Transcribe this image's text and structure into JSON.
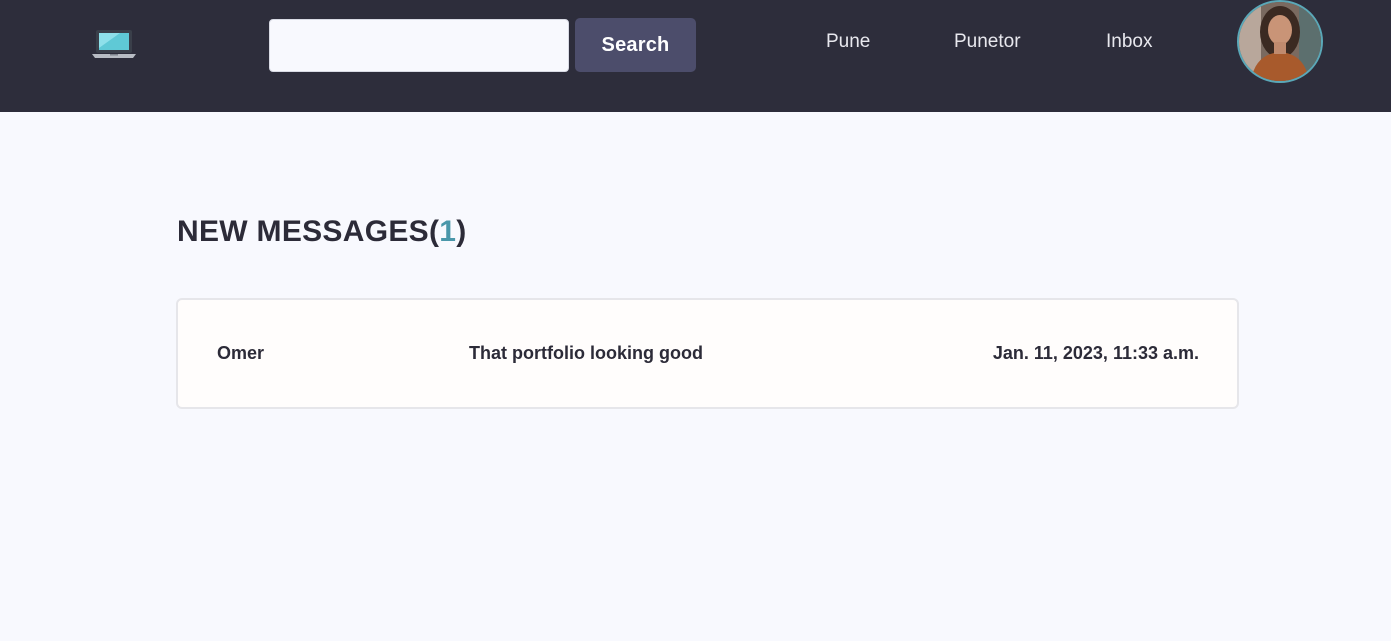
{
  "navbar": {
    "logo_icon": "laptop-icon",
    "search": {
      "placeholder": "",
      "value": "",
      "button_label": "Search"
    },
    "links": [
      "Pune",
      "Punetor",
      "Inbox"
    ],
    "avatar_icon": "user-avatar"
  },
  "main": {
    "heading_prefix": "NEW MESSAGES(",
    "heading_count": "1",
    "heading_suffix": ")",
    "messages": [
      {
        "sender": "Omer",
        "text": "That portfolio looking good",
        "date": "Jan. 11, 2023, 11:33 a.m."
      }
    ]
  },
  "colors": {
    "navbar_bg": "#2d2d3b",
    "search_button_bg": "#4c4d6b",
    "count_accent": "#4a97aa",
    "page_bg": "#f8f9fe"
  }
}
